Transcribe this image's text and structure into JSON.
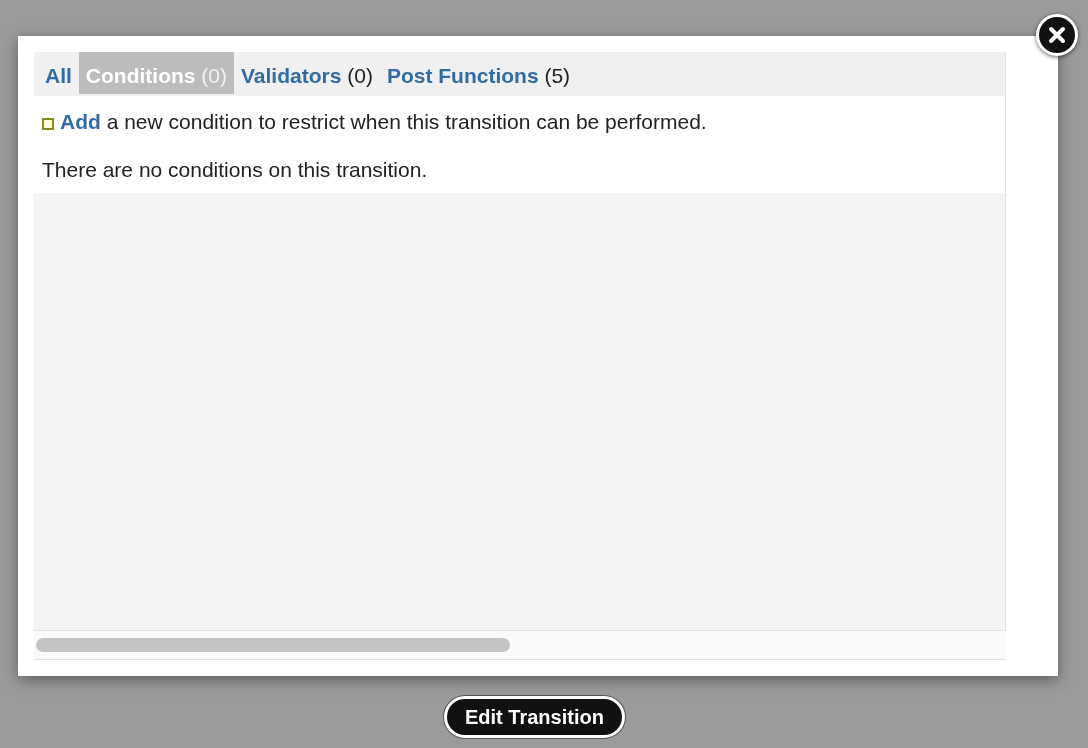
{
  "tabs": [
    {
      "label": "All",
      "selected": false
    },
    {
      "label": "Conditions",
      "count": "(0)",
      "selected": true
    },
    {
      "label": "Validators",
      "count": "(0)",
      "selected": false
    },
    {
      "label": "Post Functions",
      "count": "(5)",
      "selected": false
    }
  ],
  "add_line": {
    "link": "Add",
    "text": " a new condition to restrict when this transition can be performed."
  },
  "message": "There are no conditions on this transition.",
  "button": "Edit Transition"
}
